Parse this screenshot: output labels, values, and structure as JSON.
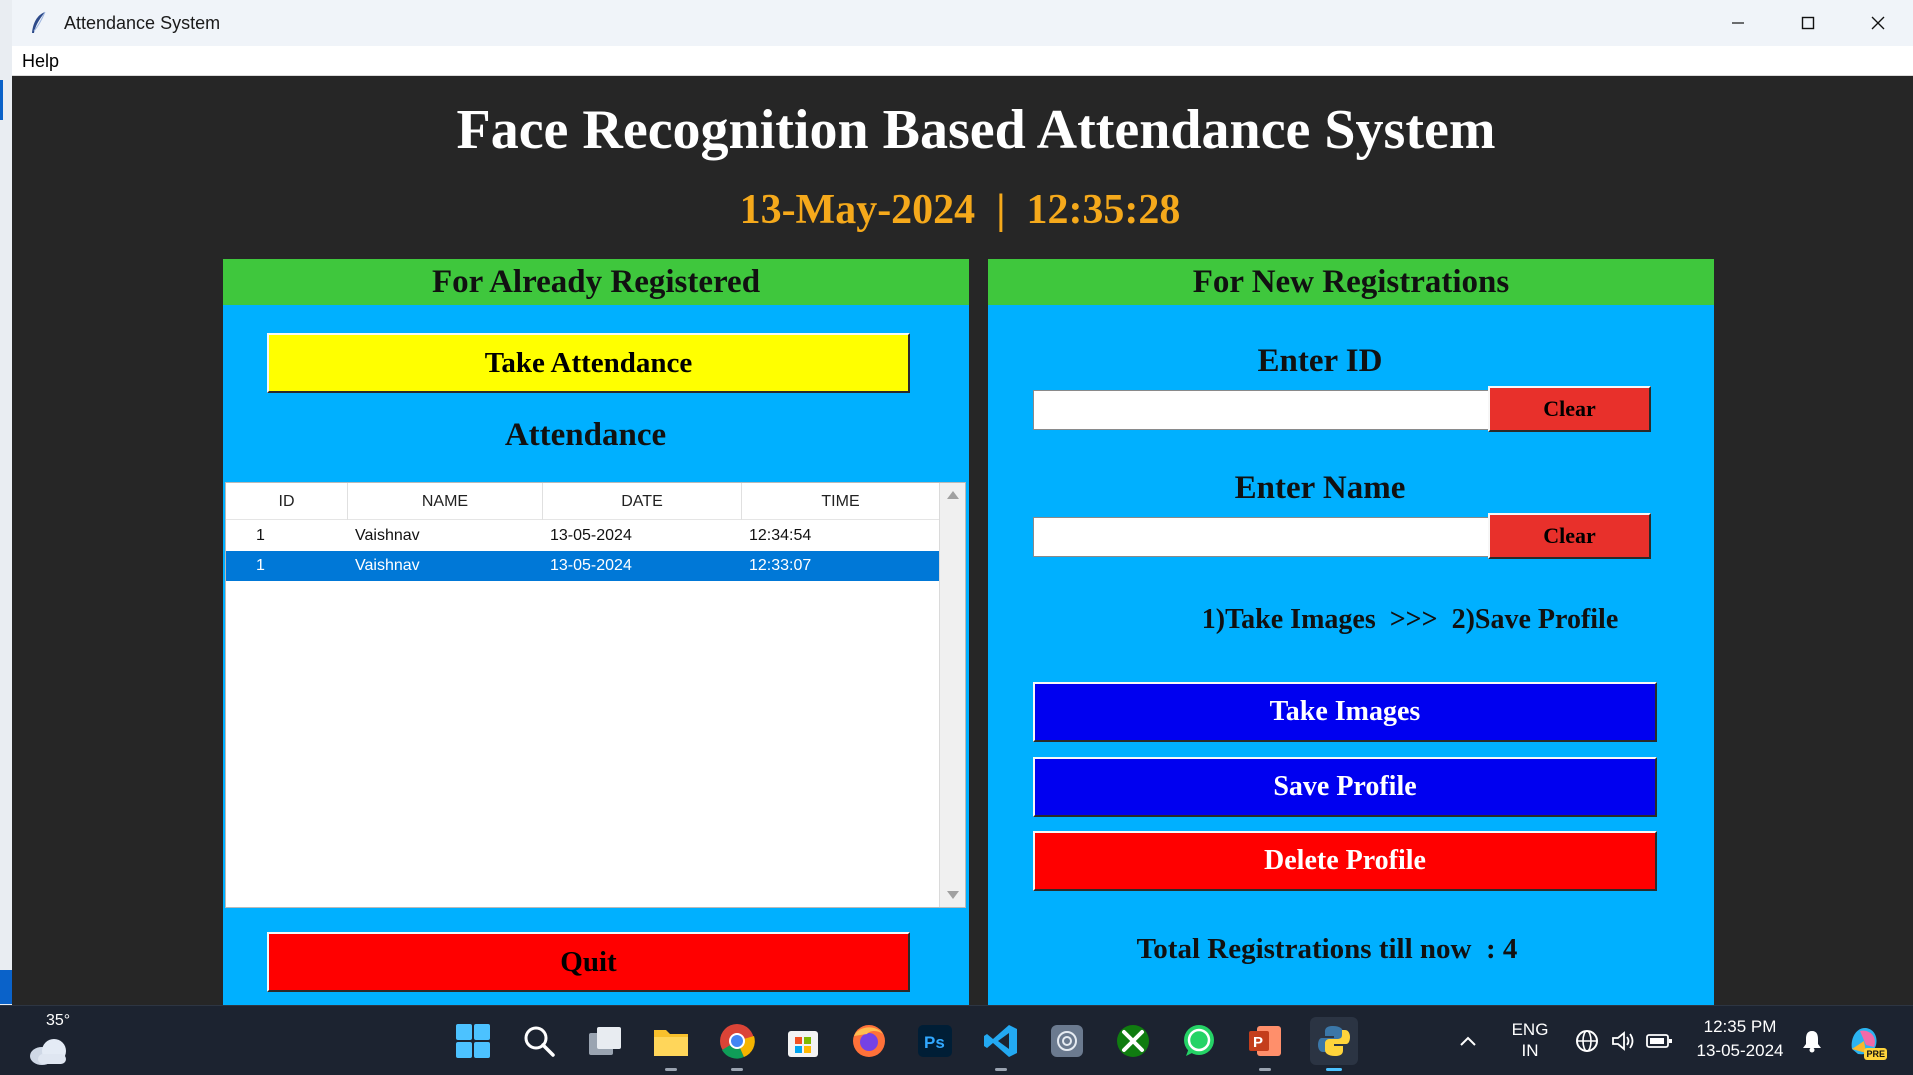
{
  "window": {
    "title": "Attendance System"
  },
  "menu": {
    "help": "Help"
  },
  "header": {
    "title": "Face Recognition Based Attendance System",
    "date": "13-May-2024",
    "separator": "|",
    "time": "12:35:28"
  },
  "left_panel": {
    "heading": "For Already Registered",
    "take_attendance_label": "Take Attendance",
    "attendance_heading": "Attendance",
    "columns": [
      "ID",
      "NAME",
      "DATE",
      "TIME"
    ],
    "rows": [
      {
        "id": "1",
        "name": "Vaishnav",
        "date": "13-05-2024",
        "time": "12:34:54"
      },
      {
        "id": "1",
        "name": "Vaishnav",
        "date": "13-05-2024",
        "time": "12:33:07"
      }
    ],
    "quit_label": "Quit"
  },
  "right_panel": {
    "heading": "For New Registrations",
    "enter_id_label": "Enter ID",
    "id_value": "",
    "clear_label": "Clear",
    "enter_name_label": "Enter Name",
    "name_value": "",
    "steps_text": "1)Take Images  >>>  2)Save Profile",
    "take_images_label": "Take Images",
    "save_profile_label": "Save Profile",
    "delete_profile_label": "Delete Profile",
    "total_text": "Total Registrations till now  : 4"
  },
  "taskbar": {
    "weather_temp": "35°",
    "language_line1": "ENG",
    "language_line2": "IN",
    "clock_time": "12:35 PM",
    "clock_date": "13-05-2024",
    "copilot_badge": "PRE"
  },
  "colors": {
    "panel_bg": "#00b0ff",
    "panel_header": "#3fc73d",
    "clock": "#f5a91b",
    "take_attendance": "#ffff00",
    "quit": "#ff0000",
    "clear": "#e8302b",
    "take_images": "#0000f0",
    "save_profile": "#0000f0",
    "delete_profile": "#ff0000",
    "selected_row": "#0078d7"
  }
}
